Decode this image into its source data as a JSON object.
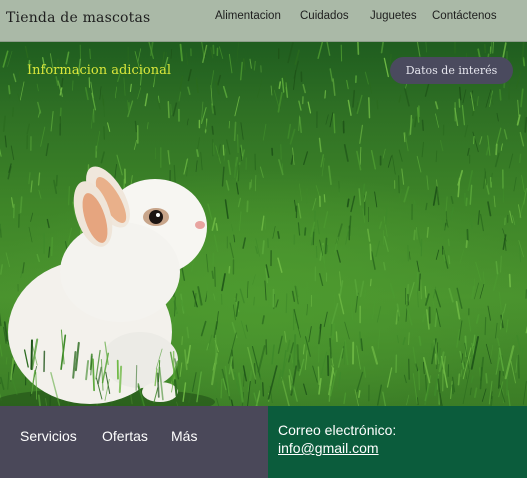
{
  "header": {
    "brand": "Tienda de mascotas",
    "nav": [
      "Alimentacion",
      "Cuidados",
      "Juguetes",
      "Contáctenos"
    ]
  },
  "hero": {
    "info_link": "Informacion adicional",
    "info_button": "Datos de interés"
  },
  "footer": {
    "links": [
      "Servicios",
      "Ofertas",
      "Más"
    ],
    "contact_label": "Correo electrónico:",
    "contact_email": "info@gmail.com"
  },
  "colors": {
    "header_bg": "#aab9a7",
    "accent_link": "#d9e63b",
    "button_bg": "#4a4a5e",
    "footer_left_bg": "#4a4859",
    "footer_right_bg": "#0b5c3c"
  }
}
